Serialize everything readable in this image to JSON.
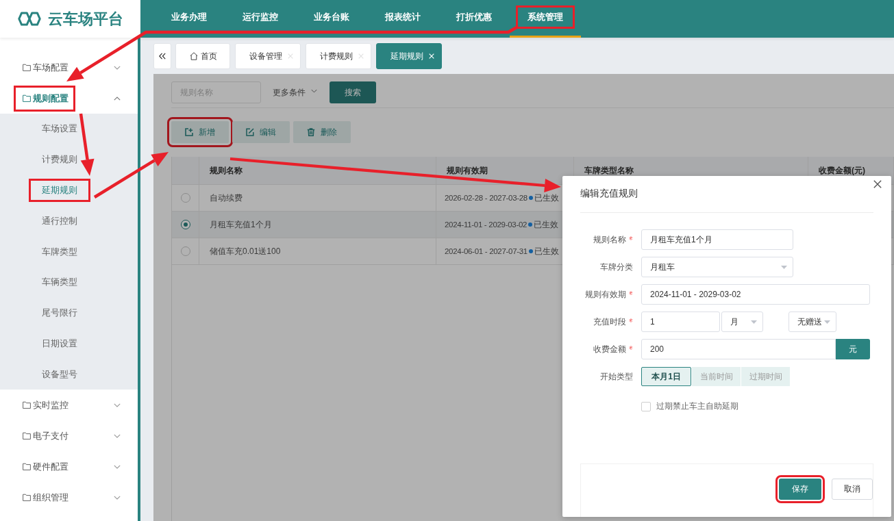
{
  "logo": {
    "name": "云车场平台"
  },
  "top_nav": [
    {
      "label": "业务办理",
      "selected": false,
      "annotated": false
    },
    {
      "label": "运行监控",
      "selected": false,
      "annotated": false
    },
    {
      "label": "业务台账",
      "selected": false,
      "annotated": false
    },
    {
      "label": "报表统计",
      "selected": false,
      "annotated": false
    },
    {
      "label": "打折优惠",
      "selected": false,
      "annotated": false
    },
    {
      "label": "系统管理",
      "selected": true,
      "annotated": true
    }
  ],
  "sidebar": {
    "items": [
      {
        "label": "车场配置",
        "expanded": false,
        "annotated": false
      },
      {
        "label": "规则配置",
        "expanded": true,
        "annotated": true,
        "children": [
          {
            "label": "车场设置",
            "selected": false,
            "annotated": false
          },
          {
            "label": "计费规则",
            "selected": false,
            "annotated": false
          },
          {
            "label": "延期规则",
            "selected": true,
            "annotated": true
          },
          {
            "label": "通行控制",
            "selected": false,
            "annotated": false
          },
          {
            "label": "车牌类型",
            "selected": false,
            "annotated": false
          },
          {
            "label": "车辆类型",
            "selected": false,
            "annotated": false
          },
          {
            "label": "尾号限行",
            "selected": false,
            "annotated": false
          },
          {
            "label": "日期设置",
            "selected": false,
            "annotated": false
          },
          {
            "label": "设备型号",
            "selected": false,
            "annotated": false
          }
        ]
      },
      {
        "label": "实时监控",
        "expanded": false,
        "annotated": false
      },
      {
        "label": "电子支付",
        "expanded": false,
        "annotated": false
      },
      {
        "label": "硬件配置",
        "expanded": false,
        "annotated": false
      },
      {
        "label": "组织管理",
        "expanded": false,
        "annotated": false
      }
    ]
  },
  "tabs": [
    {
      "label": "首页",
      "kind": "home",
      "selected": false
    },
    {
      "label": "设备管理",
      "kind": "page",
      "selected": false
    },
    {
      "label": "计费规则",
      "kind": "page",
      "selected": false
    },
    {
      "label": "延期规则",
      "kind": "page",
      "selected": true
    }
  ],
  "filters": {
    "name_placeholder": "规则名称",
    "more_label": "更多条件",
    "search_button": "搜索"
  },
  "toolbar": [
    {
      "label": "新增",
      "kind": "add",
      "annotated": true
    },
    {
      "label": "编辑",
      "kind": "edit",
      "annotated": false
    },
    {
      "label": "删除",
      "kind": "delete",
      "annotated": false
    }
  ],
  "table": {
    "columns": [
      "规则名称",
      "规则有效期",
      "车牌类型名称",
      "收费金额(元)"
    ],
    "rows": [
      {
        "selected": false,
        "name": "自动续费",
        "validity": "2026-02-28 - 2027-03-28",
        "status": "已生效"
      },
      {
        "selected": true,
        "name": "月租车充值1个月",
        "validity": "2024-11-01 - 2029-03-02",
        "status": "已生效"
      },
      {
        "selected": false,
        "name": "储值车充0.01送100",
        "validity": "2024-06-01 - 2027-07-31",
        "status": "已生效"
      }
    ]
  },
  "dialog": {
    "title": "编辑充值规则",
    "fields": [
      {
        "kind": "text",
        "label": "规则名称",
        "required": true,
        "value": "月租车充值1个月"
      },
      {
        "kind": "select",
        "label": "车牌分类",
        "required": false,
        "value": "月租车"
      },
      {
        "kind": "date_range",
        "label": "规则有效期",
        "required": true,
        "value": "2024-11-01 - 2029-03-02"
      },
      {
        "kind": "period",
        "label": "充值时段",
        "required": true,
        "value": "1",
        "unit": "月",
        "bonus": "无赠送"
      },
      {
        "kind": "amount",
        "label": "收费金额",
        "required": true,
        "value": "200",
        "addon": "元"
      },
      {
        "kind": "segmented",
        "label": "开始类型",
        "required": false,
        "options": [
          {
            "label": "本月1日",
            "selected": true
          },
          {
            "label": "当前时间",
            "selected": false
          },
          {
            "label": "过期时间",
            "selected": false
          }
        ]
      }
    ],
    "checkbox": {
      "label": "过期禁止车主自助延期",
      "checked": false
    },
    "buttons": [
      {
        "label": "保存",
        "kind": "primary",
        "annotated": true
      },
      {
        "label": "取消",
        "kind": "default",
        "annotated": false
      }
    ]
  }
}
